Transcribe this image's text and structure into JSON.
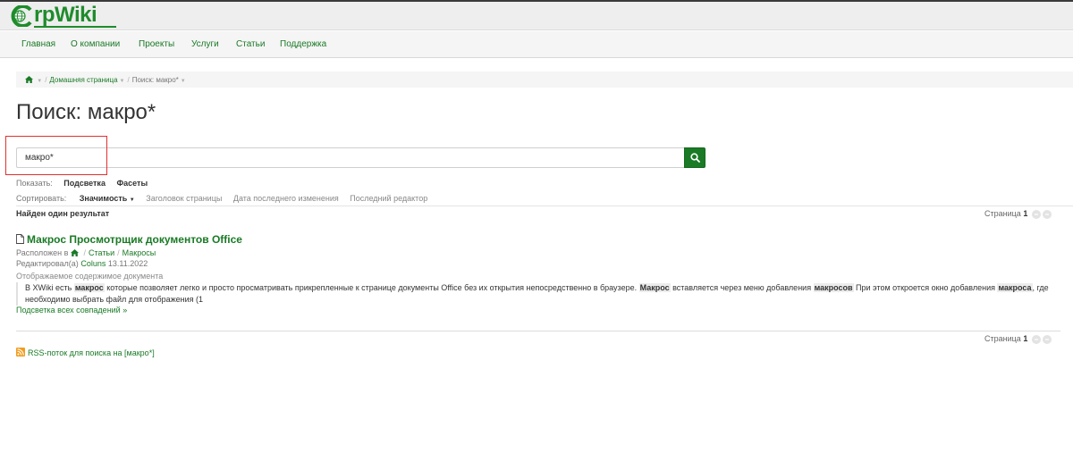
{
  "logo": {
    "text": "rpWiki"
  },
  "nav": {
    "items": [
      {
        "label": "Главная"
      },
      {
        "label": "О компании"
      },
      {
        "label": "Проекты"
      },
      {
        "label": "Услуги"
      },
      {
        "label": "Статьи"
      },
      {
        "label": "Поддержка"
      }
    ]
  },
  "breadcrumb": {
    "home_icon": "home-icon",
    "items": [
      {
        "label": "Домашняя страница"
      },
      {
        "label": "Поиск: макро*"
      }
    ]
  },
  "page": {
    "title": "Поиск: макро*"
  },
  "search": {
    "value": "макро*",
    "button_icon": "search-icon"
  },
  "show": {
    "label": "Показать:",
    "options": [
      {
        "label": "Подсветка"
      },
      {
        "label": "Фасеты"
      }
    ]
  },
  "sort": {
    "label": "Сортировать:",
    "options": [
      {
        "label": "Значимость"
      },
      {
        "label": "Заголовок страницы"
      },
      {
        "label": "Дата последнего изменения"
      },
      {
        "label": "Последний редактор"
      }
    ]
  },
  "results": {
    "summary": "Найден один результат",
    "pager_label": "Страница",
    "pager_current": "1",
    "items": [
      {
        "title": "Макрос Просмотрщик документов Office",
        "location_label": "Расположен в",
        "location_path": [
          {
            "label": "Статьи"
          },
          {
            "label": "Макросы"
          }
        ],
        "edited_label": "Редактировал(а)",
        "editor": "Coluns",
        "date": "13.11.2022",
        "content_label": "Отображаемое содержимое документа",
        "snippet": {
          "t1": "В XWiki есть ",
          "h1": "макрос",
          "t2": " которые позволяет легко и просто просматривать прикрепленные к странице документы Office без их открытия непосредственно в браузере. ",
          "h2": "Макрос",
          "t3": " вставляется через меню добавления ",
          "h3": "макросов",
          "t4": " При этом откроется окно добавления ",
          "h4": "макроса",
          "t5": ", где необходимо выбрать файл для отображения (1"
        },
        "all_matches": "Подсветка всех совпадений »"
      }
    ]
  },
  "rss": {
    "label": "RSS-поток для поиска на [макро*]"
  },
  "colors": {
    "brand": "#1a7a26",
    "highlight_box": "#e0312e",
    "rss": "#f29c1f"
  }
}
